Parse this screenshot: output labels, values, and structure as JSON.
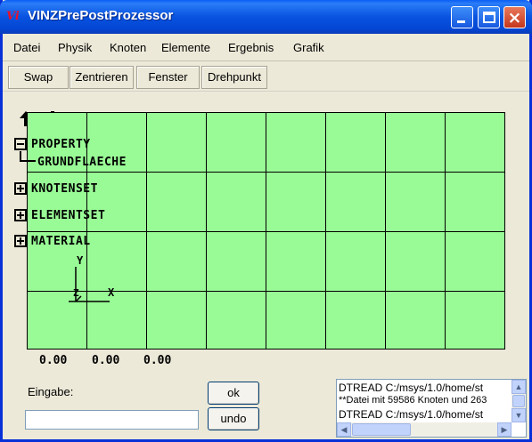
{
  "window": {
    "title": "VINZPrePostProzessor",
    "app_icon_text": "Vi",
    "controls": {
      "minimize": "minimize",
      "maximize": "maximize",
      "close": "×"
    }
  },
  "menu": [
    "Datei",
    "Physik",
    "Knoten",
    "Elemente",
    "Ergebnis",
    "Grafik"
  ],
  "toolbar": [
    "Swap",
    "Zentrieren",
    "Fenster",
    "Drehpunkt"
  ],
  "canvas": {
    "background": "#99fb96",
    "tree": {
      "property": "PROPERTY",
      "property_child": "GRUNDFLAECHE",
      "knotenset": "KNOTENSET",
      "elementset": "ELEMENTSET",
      "material": "MATERIAL"
    },
    "axes": {
      "y": "Y",
      "z": "Z",
      "x": "X"
    },
    "coordinates": [
      "0.00",
      "0.00",
      "0.00"
    ]
  },
  "input": {
    "label": "Eingabe:",
    "value": ""
  },
  "buttons": {
    "ok": "ok",
    "undo": "undo"
  },
  "log": {
    "lines": [
      "DTREAD C:/msys/1.0/home/st",
      "**Datei mit 59586 Knoten und 263",
      "DTREAD C:/msys/1.0/home/st"
    ]
  },
  "colors": {
    "titlebar": "#0853e0",
    "canvas": "#99fb96",
    "close_button": "#c5371d"
  }
}
